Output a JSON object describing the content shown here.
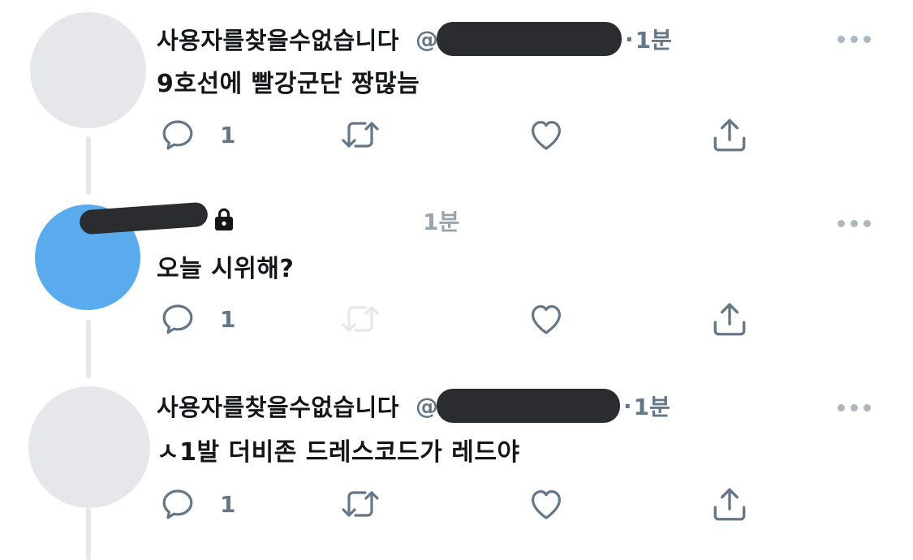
{
  "tweets": [
    {
      "display_name": "사용자를찾을수없습니다",
      "handle_prefix": "@",
      "separator": "·",
      "time": "1분",
      "text": "9호선에 빨강군단 짱많늠",
      "reply_count": "1"
    },
    {
      "display_name": "",
      "handle_prefix": "",
      "separator": "",
      "time": "1분",
      "text": "오늘 시위해?",
      "reply_count": "1",
      "protected": true
    },
    {
      "display_name": "사용자를찾을수없습니다",
      "handle_prefix": "@",
      "separator": "·",
      "time": "1분",
      "text": "ㅅ1발 더비존 드레스코드가 레드야",
      "reply_count": "1"
    }
  ],
  "icons": {
    "reply": "reply-icon",
    "retweet": "retweet-icon",
    "like": "heart-icon",
    "share": "share-icon",
    "more": "more-icon",
    "lock": "lock-icon"
  },
  "colors": {
    "text": "#14171a",
    "secondary": "#657786",
    "icon": "#657786",
    "avatar_gray": "#e6e7ea",
    "avatar_blue": "#5aabee",
    "thread_line": "#e6e7e9"
  }
}
